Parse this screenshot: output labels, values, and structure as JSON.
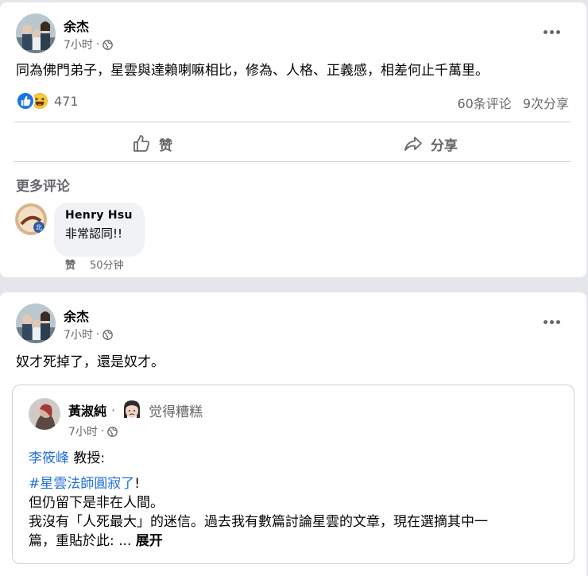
{
  "post1": {
    "author": "余杰",
    "time": "7小时",
    "separator": "·",
    "text": "同為佛門弟子，星雲與達賴喇嘛相比，修為、人格、正義感，相差何止千萬里。",
    "reaction_count": "471",
    "comments_count": "60条评论",
    "shares_count": "9次分享",
    "like_label": "赞",
    "share_label": "分享",
    "more_comments_label": "更多评论",
    "comment": {
      "author": "Henry Hsu",
      "text": "非常認同!!",
      "like_label": "赞",
      "time": "50分钟"
    }
  },
  "post2": {
    "author": "余杰",
    "time": "7小时",
    "separator": "·",
    "text": "奴才死掉了，還是奴才。",
    "shared": {
      "author": "黃淑純",
      "separator": "·",
      "feeling": "觉得糟糕",
      "time": "7小时",
      "mention": "李筱峰",
      "mention_suffix": " 教授:",
      "hashtag": "#星雲法師圓寂了",
      "hashtag_suffix": "!",
      "line3": "但仍留下是非在人間。",
      "line4": "我沒有「人死最大」的迷信。過去我有數篇討論星雲的文章，現在選摘其中一",
      "line5": "篇，重貼於此: ...",
      "see_more": "展开"
    }
  },
  "colors": {
    "link": "#216fdb",
    "like_blue": "#1b74e4",
    "haha_yellow": "#f7b125",
    "muted": "#65676b"
  },
  "icons": [
    "globe-icon",
    "more-options-icon",
    "like-reaction-icon",
    "haha-reaction-icon",
    "thumbs-up-icon",
    "share-arrow-icon",
    "feeling-face-icon"
  ]
}
